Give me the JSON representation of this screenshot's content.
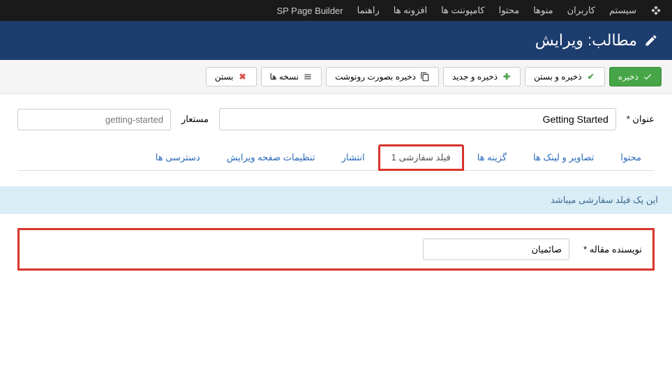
{
  "topbar": {
    "items": [
      "سیستم",
      "کاربران",
      "منوها",
      "محتوا",
      "کامپوننت ها",
      "افزونه ها",
      "راهنما",
      "SP Page Builder"
    ]
  },
  "titlebar": {
    "title": "مطالب: ویرایش"
  },
  "toolbar": {
    "save": "ذخیره",
    "save_close": "ذخیره و بستن",
    "save_new": "ذخیره و جدید",
    "save_copy": "ذخیره بصورت رونوشت",
    "versions": "نسخه ها",
    "close": "بستن"
  },
  "form": {
    "title_label": "عنوان *",
    "title_value": "Getting Started",
    "alias_label": "مستعار",
    "alias_value": "getting-started"
  },
  "tabs": {
    "items": [
      {
        "label": "محتوا",
        "active": false
      },
      {
        "label": "تصاویر و لینک ها",
        "active": false
      },
      {
        "label": "گزینه ها",
        "active": false
      },
      {
        "label": "فیلد سفارشی 1",
        "active": true,
        "highlighted": true
      },
      {
        "label": "انتشار",
        "active": false
      },
      {
        "label": "تنظیمات صفحه ویرایش",
        "active": false
      },
      {
        "label": "دسترسی ها",
        "active": false
      }
    ]
  },
  "info": {
    "text": "این یک فیلد سفارشی میباشد"
  },
  "field": {
    "label": "نویسنده مقاله *",
    "value": "صائمیان"
  }
}
